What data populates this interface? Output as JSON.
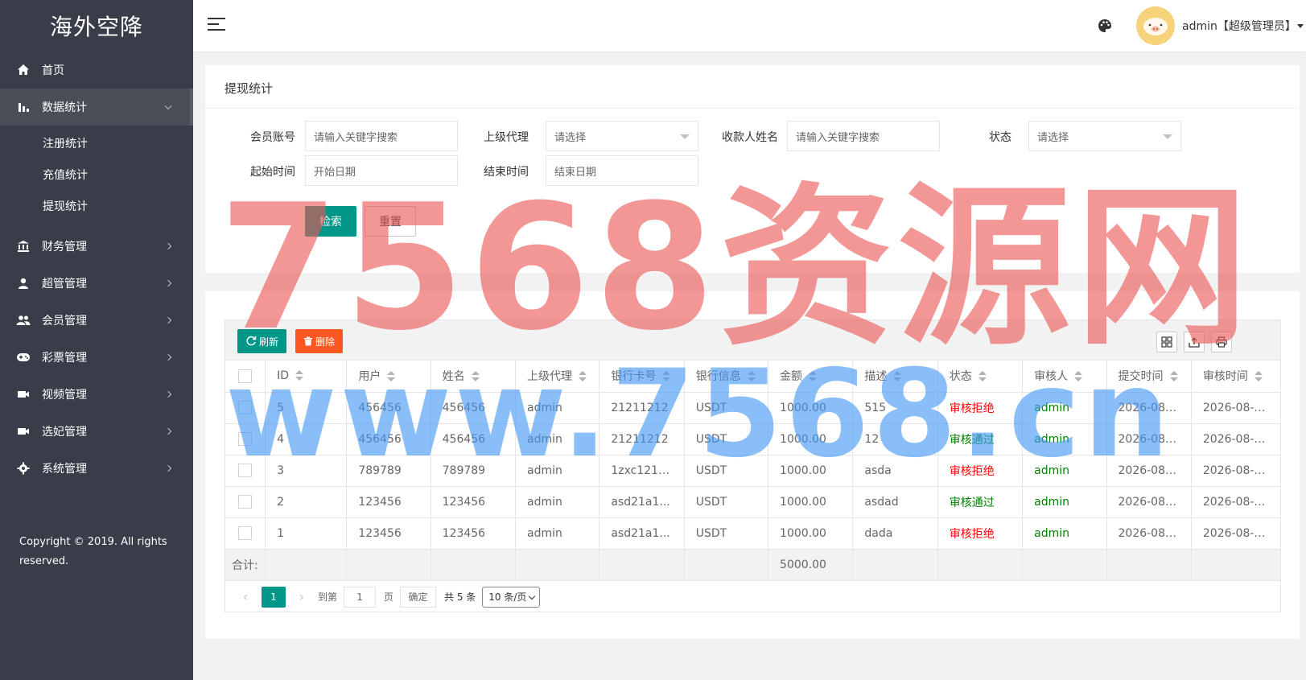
{
  "app": {
    "logo": "海外空降"
  },
  "sidebar": {
    "items": [
      {
        "label": "首页",
        "icon": "home-icon"
      },
      {
        "label": "数据统计",
        "icon": "bar-chart-icon"
      },
      {
        "label": "财务管理",
        "icon": "bank-icon"
      },
      {
        "label": "超管管理",
        "icon": "user-icon"
      },
      {
        "label": "会员管理",
        "icon": "users-icon"
      },
      {
        "label": "彩票管理",
        "icon": "gamepad-icon"
      },
      {
        "label": "视频管理",
        "icon": "video-icon"
      },
      {
        "label": "选妃管理",
        "icon": "video-icon"
      },
      {
        "label": "系统管理",
        "icon": "gear-icon"
      }
    ],
    "sub_items": [
      "注册统计",
      "充值统计",
      "提现统计"
    ],
    "copyright": "Copyright © 2019. All rights reserved."
  },
  "header": {
    "user": "admin【超级管理员】"
  },
  "search": {
    "title": "提现统计",
    "member_label": "会员账号",
    "member_placeholder": "请输入关键字搜索",
    "agent_label": "上级代理",
    "agent_value": "请选择",
    "payee_label": "收款人姓名",
    "payee_placeholder": "请输入关键字搜索",
    "status_label": "状态",
    "status_value": "请选择",
    "start_label": "起始时间",
    "start_placeholder": "开始日期",
    "end_label": "结束时间",
    "end_placeholder": "结束日期",
    "search_btn": "检索",
    "reset_btn": "重置"
  },
  "toolbar": {
    "refresh": "刷新",
    "delete": "删除"
  },
  "table": {
    "columns": [
      "ID",
      "用户",
      "姓名",
      "上级代理",
      "银行卡号",
      "银行信息",
      "金额",
      "描述",
      "状态",
      "审核人",
      "提交时间",
      "审核时间"
    ],
    "rows": [
      {
        "id": "5",
        "user": "456456",
        "name": "456456",
        "agent": "admin",
        "card": "21211212",
        "bank": "USDT",
        "amount": "1000.00",
        "desc": "515",
        "status": "审核拒绝",
        "status_type": "reject",
        "auditor": "admin",
        "submit": "2026-08-...",
        "audit": "2026-08-0..."
      },
      {
        "id": "4",
        "user": "456456",
        "name": "456456",
        "agent": "admin",
        "card": "21211212",
        "bank": "USDT",
        "amount": "1000.00",
        "desc": "12",
        "status": "审核通过",
        "status_type": "pass",
        "auditor": "admin",
        "submit": "2026-08-...",
        "audit": "2026-08-0..."
      },
      {
        "id": "3",
        "user": "789789",
        "name": "789789",
        "agent": "admin",
        "card": "1zxc1212...",
        "bank": "USDT",
        "amount": "1000.00",
        "desc": "asda",
        "status": "审核拒绝",
        "status_type": "reject",
        "auditor": "admin",
        "submit": "2026-08-...",
        "audit": "2026-08-0..."
      },
      {
        "id": "2",
        "user": "123456",
        "name": "123456",
        "agent": "admin",
        "card": "asd21a1...",
        "bank": "USDT",
        "amount": "1000.00",
        "desc": "asdad",
        "status": "审核通过",
        "status_type": "pass",
        "auditor": "admin",
        "submit": "2026-08-...",
        "audit": "2026-08-0..."
      },
      {
        "id": "1",
        "user": "123456",
        "name": "123456",
        "agent": "admin",
        "card": "asd21a1...",
        "bank": "USDT",
        "amount": "1000.00",
        "desc": "dada",
        "status": "审核拒绝",
        "status_type": "reject",
        "auditor": "admin",
        "submit": "2026-08-...",
        "audit": "2026-08-0..."
      }
    ],
    "total_label": "合计:",
    "total_amount": "5000.00"
  },
  "pager": {
    "current": "1",
    "goto_label": "到第",
    "goto_value": "1",
    "page_unit": "页",
    "confirm": "确定",
    "total": "共 5 条",
    "limit": "10 条/页"
  },
  "watermark": {
    "line1": "7568资源网",
    "line2": "www.7568.cn"
  },
  "colors": {
    "sidebar": "#393d49",
    "primary": "#009688",
    "danger": "#ff5722",
    "reject": "#ff0000",
    "pass": "#008000"
  }
}
